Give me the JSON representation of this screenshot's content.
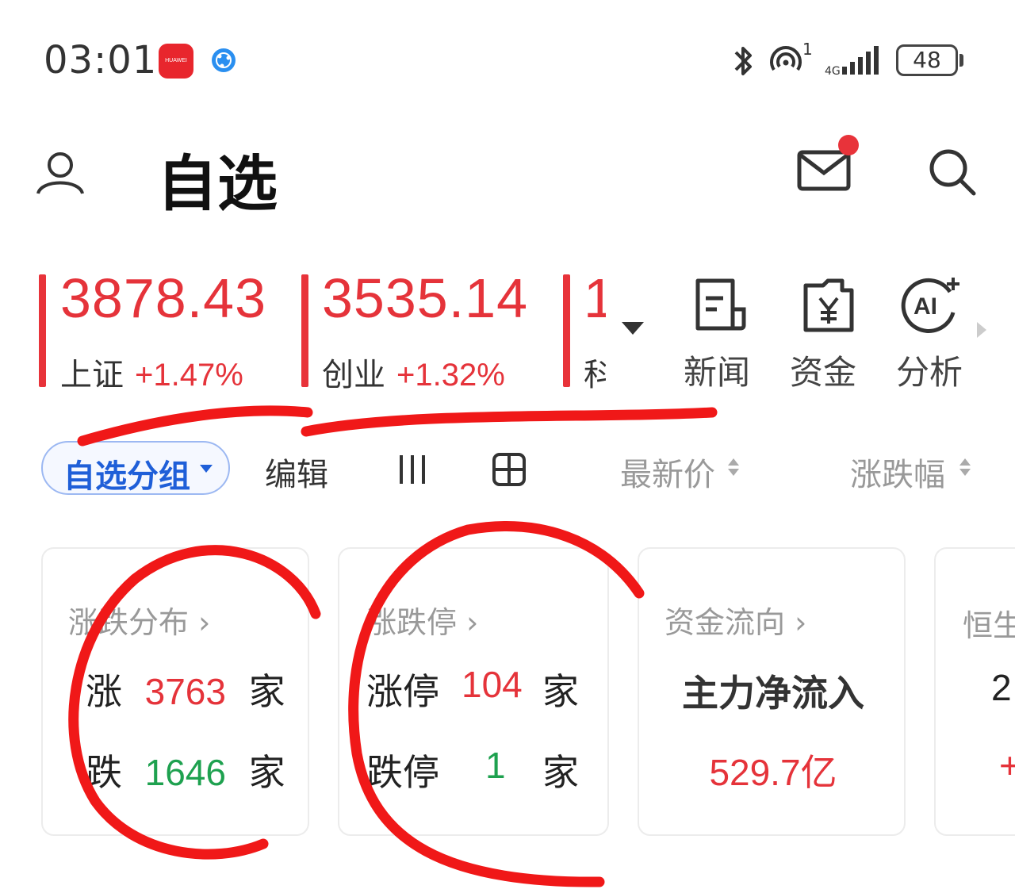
{
  "status_bar": {
    "time": "03:01",
    "app_badge_text": "HUAWEI",
    "wifi_label": "1",
    "battery": "48"
  },
  "header": {
    "title": "自选",
    "icons": [
      "person-icon",
      "mail-icon",
      "search-icon"
    ]
  },
  "indices": [
    {
      "value": "3878.43",
      "name": "上证",
      "change": "+1.47%"
    },
    {
      "value": "3535.14",
      "name": "创业",
      "change": "+1.32%"
    },
    {
      "value": "1",
      "name": "科"
    }
  ],
  "tools": [
    {
      "label": "新闻",
      "icon": "news-icon"
    },
    {
      "label": "资金",
      "icon": "yuan-money-icon"
    },
    {
      "label": "分析",
      "icon": "ai-analysis-icon"
    }
  ],
  "toolbar": {
    "group_label": "自选分组",
    "edit_label": "编辑",
    "sort_price_label": "最新价",
    "sort_change_label": "涨跌幅"
  },
  "cards": {
    "distribution": {
      "title": "涨跌分布 ›",
      "up_label": "涨",
      "up_count": "3763",
      "down_label": "跌",
      "down_count": "1646",
      "unit": "家"
    },
    "limit": {
      "title": "涨跌停 ›",
      "up_label": "涨停",
      "up_count": "104",
      "down_label": "跌停",
      "down_count": "1",
      "unit": "家"
    },
    "flow": {
      "title": "资金流向 ›",
      "label": "主力净流入",
      "value": "529.7亿"
    },
    "hsi": {
      "title": "恒生",
      "line1": "2",
      "line2": "+"
    }
  },
  "colors": {
    "up": "#e5333a",
    "down": "#1ea14f",
    "accent": "#1f5fd8",
    "annotation": "#f01818"
  }
}
